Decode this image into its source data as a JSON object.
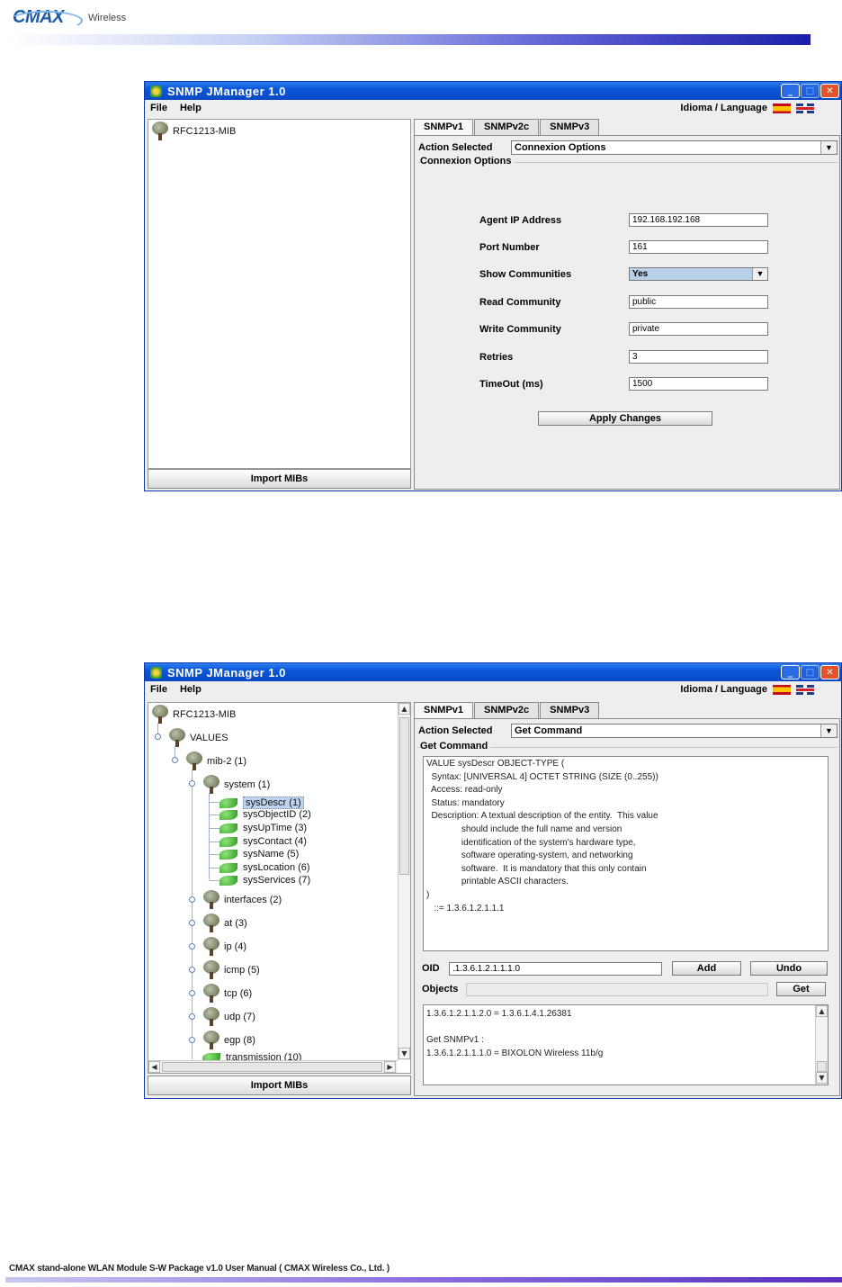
{
  "page": {
    "logo": {
      "brand": "CMAX",
      "sub": "Wireless"
    },
    "footer": "CMAX stand-alone WLAN Module S-W Package v1.0 User Manual ( CMAX Wireless Co., Ltd. )"
  },
  "window": {
    "title": "SNMP JManager 1.0",
    "menu": [
      "File",
      "Help"
    ],
    "language_label": "Idioma / Language",
    "tabs": [
      "SNMPv1",
      "SNMPv2c",
      "SNMPv3"
    ],
    "import_button": "Import MIBs",
    "action_label": "Action Selected"
  },
  "screen1": {
    "tree_root": "RFC1213-MIB",
    "action_selected": "Connexion Options",
    "group_title": "Connexion Options",
    "fields": [
      {
        "label": "Agent IP Address",
        "value": "192.168.192.168"
      },
      {
        "label": "Port Number",
        "value": "161"
      },
      {
        "label": "Show Communities",
        "value": "Yes"
      },
      {
        "label": "Read Community",
        "value": "public"
      },
      {
        "label": "Write Community",
        "value": "private"
      },
      {
        "label": "Retries",
        "value": "3"
      },
      {
        "label": "TimeOut (ms)",
        "value": "1500"
      }
    ],
    "apply_button": "Apply Changes"
  },
  "screen2": {
    "tree": {
      "root": "RFC1213-MIB",
      "values": "VALUES",
      "mib2": "mib-2 (1)",
      "system": "system (1)",
      "system_children": [
        "sysDescr (1)",
        "sysObjectID (2)",
        "sysUpTime (3)",
        "sysContact (4)",
        "sysName (5)",
        "sysLocation (6)",
        "sysServices (7)"
      ],
      "others": [
        "interfaces (2)",
        "at (3)",
        "ip (4)",
        "icmp (5)",
        "tcp (6)",
        "udp (7)",
        "egp (8)"
      ],
      "transmission": "transmission (10)"
    },
    "action_selected": "Get Command",
    "group_title": "Get Command",
    "description": "VALUE sysDescr OBJECT-TYPE (\n  Syntax: [UNIVERSAL 4] OCTET STRING (SIZE (0..255))\n  Access: read-only\n  Status: mandatory\n  Description: A textual description of the entity.  This value\n              should include the full name and version\n              identification of the system's hardware type,\n              software operating-system, and networking\n              software.  It is mandatory that this only contain\n              printable ASCII characters.\n)\n   ::= 1.3.6.1.2.1.1.1",
    "oid_label": "OID",
    "oid_value": ".1.3.6.1.2.1.1.1.0",
    "add_button": "Add",
    "undo_button": "Undo",
    "objects_label": "Objects",
    "objects_value": "",
    "get_button": "Get",
    "output": "1.3.6.1.2.1.1.2.0 = 1.3.6.1.4.1.26381\n\nGet SNMPv1 :\n1.3.6.1.2.1.1.1.0 = BIXOLON Wireless 11b/g"
  }
}
